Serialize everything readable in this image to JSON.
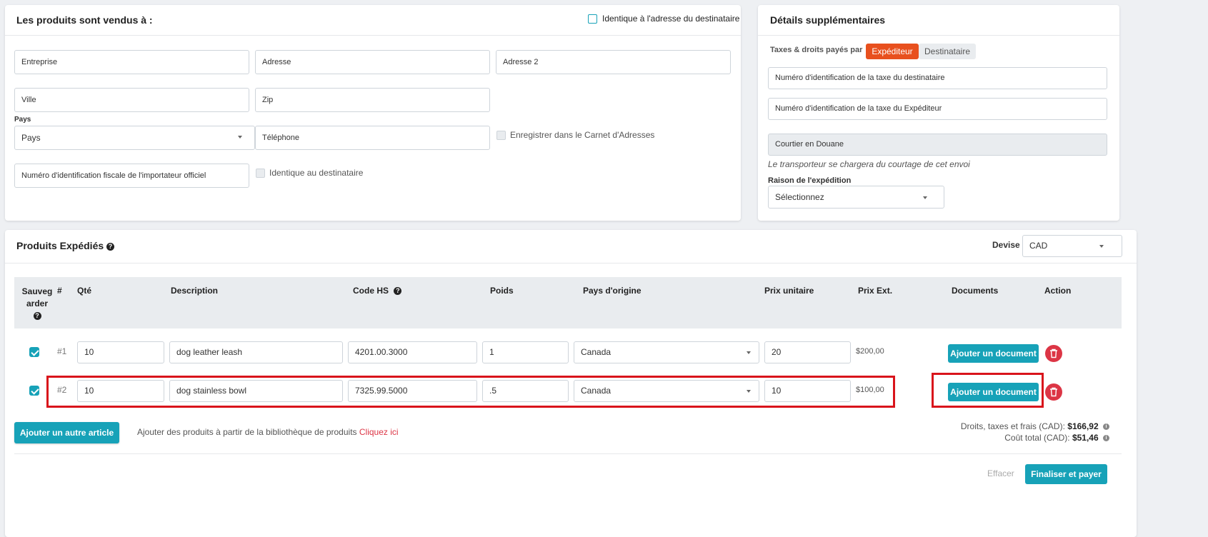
{
  "seller": {
    "title": "Les produits sont vendus à :",
    "same_as_recipient_label": "Identique à l'adresse du destinataire",
    "company_placeholder": "Entreprise",
    "address_placeholder": "Adresse",
    "address2_placeholder": "Adresse 2",
    "city_placeholder": "Ville",
    "zip_placeholder": "Zip",
    "country_label": "Pays",
    "country_value": "Pays",
    "phone_placeholder": "Téléphone",
    "save_address_book_label": "Enregistrer dans le Carnet d'Adresses",
    "importer_tax_id_placeholder": "Numéro d'identification fiscale de l'importateur officiel",
    "same_as_recipient2_label": "Identique au destinataire"
  },
  "details": {
    "title": "Détails supplémentaires",
    "taxes_paid_by_label": "Taxes & droits payés par",
    "toggle_sender": "Expéditeur",
    "toggle_recipient": "Destinataire",
    "recipient_tax_id_placeholder": "Numéro d'identification de la taxe du destinataire",
    "sender_tax_id_placeholder": "Numéro d'identification de la taxe du Expéditeur",
    "customs_broker_placeholder": "Courtier en Douane",
    "carrier_note": "Le transporteur se chargera du courtage de cet envoi",
    "shipment_reason_label": "Raison de l'expédition",
    "shipment_reason_value": "Sélectionnez"
  },
  "products": {
    "title": "Produits Expédiés",
    "currency_label": "Devise",
    "currency_value": "CAD",
    "headers": {
      "save": "Sauvegarder",
      "num": "#",
      "qty": "Qté",
      "description": "Description",
      "hs_code": "Code HS",
      "weight": "Poids",
      "origin": "Pays d'origine",
      "unit_price": "Prix unitaire",
      "ext_price": "Prix Ext.",
      "documents": "Documents",
      "action": "Action"
    },
    "rows": [
      {
        "num": "#1",
        "qty": "10",
        "description": "dog leather leash",
        "hs_code": "4201.00.3000",
        "weight": "1",
        "origin": "Canada",
        "unit_price": "20",
        "ext_price": "$200,00",
        "doc_button": "Ajouter un document"
      },
      {
        "num": "#2",
        "qty": "10",
        "description": "dog stainless bowl",
        "hs_code": "7325.99.5000",
        "weight": ".5",
        "origin": "Canada",
        "unit_price": "10",
        "ext_price": "$100,00",
        "doc_button": "Ajouter un document"
      }
    ],
    "add_item_button": "Ajouter un autre article",
    "library_text": "Ajouter des produits à partir de la bibliothèque de produits",
    "library_link": "Cliquez ici",
    "duties_label": "Droits, taxes et frais (CAD):",
    "duties_value": "$166,92",
    "total_label": "Coût total (CAD):",
    "total_value": "$51,46",
    "clear_button": "Effacer",
    "finalize_button": "Finaliser et payer"
  },
  "colors": {
    "accent": "#17a2b8",
    "active_toggle": "#e8501e",
    "danger": "#dc3545",
    "highlight": "#d9141b",
    "link": "#dc3545"
  }
}
